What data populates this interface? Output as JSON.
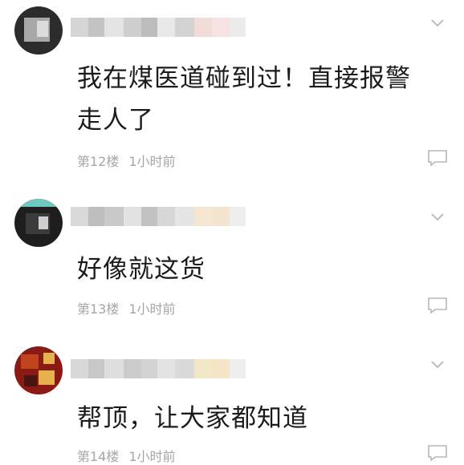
{
  "comments": [
    {
      "text": "我在煤医道碰到过！直接报警走人了",
      "floor": "第12楼",
      "time": "1小时前",
      "avatar_colors": [
        "#2c2c2c",
        "#a8a8a8",
        "#3a3a3a",
        "#dcdcdc"
      ],
      "name_colors": [
        "#d6d6d6",
        "#c4c4c4",
        "#e4e4e4",
        "#cfcfcf",
        "#bdbdbd",
        "#e9e9e9",
        "#d3d3d3",
        "#f1dcd8",
        "#f6e2e2",
        "#ececec"
      ]
    },
    {
      "text": "好像就这货",
      "floor": "第13楼",
      "time": "1小时前",
      "avatar_colors": [
        "#1e1e1e",
        "#6fc9c2",
        "#3b3b3b",
        "#cfcfcf"
      ],
      "name_colors": [
        "#d9d9d9",
        "#bebebe",
        "#c9c9c9",
        "#e2e2e2",
        "#c2c2c2",
        "#d7d7d7",
        "#e5e5e5",
        "#f4e6d0",
        "#f3e4cf",
        "#eeeeee"
      ]
    },
    {
      "text": "帮顶，让大家都知道",
      "floor": "第14楼",
      "time": "1小时前",
      "avatar_colors": [
        "#8b1a14",
        "#c0451f",
        "#e6b24e",
        "#4a1410"
      ],
      "name_colors": [
        "#d8d8d8",
        "#c7c7c7",
        "#dedede",
        "#cccccc",
        "#d2d2d2",
        "#e3e3e3",
        "#dadada",
        "#f2e7c6",
        "#f3e5c5",
        "#eeeeee"
      ]
    }
  ],
  "icons": {
    "expand": "chevron-down-icon",
    "reply": "comment-bubble-icon"
  }
}
